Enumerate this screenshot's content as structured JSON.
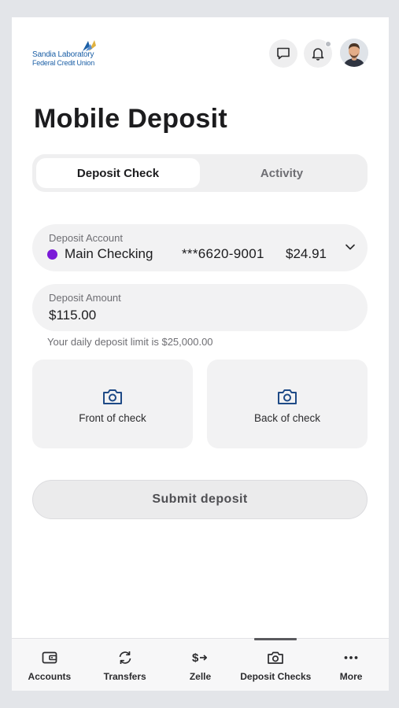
{
  "header": {
    "logo_line1": "Sandia Laboratory",
    "logo_line2": "Federal Credit Union",
    "icons": [
      "chat-icon",
      "bell-icon",
      "avatar"
    ]
  },
  "page": {
    "title": "Mobile Deposit"
  },
  "tabs": [
    {
      "label": "Deposit Check",
      "active": true
    },
    {
      "label": "Activity",
      "active": false
    }
  ],
  "deposit_account": {
    "label": "Deposit Account",
    "name": "Main Checking",
    "number": "***6620-9001",
    "balance": "$24.91",
    "dot_color": "#7a19d8"
  },
  "deposit_amount": {
    "label": "Deposit Amount",
    "value": "$115.00"
  },
  "limit_note": "Your daily deposit limit is $25,000.00",
  "check_tiles": {
    "front_label": "Front of check",
    "back_label": "Back of check"
  },
  "submit_label": "Submit deposit",
  "bottom_nav": [
    {
      "label": "Accounts",
      "icon": "wallet-icon"
    },
    {
      "label": "Transfers",
      "icon": "transfer-arrows-icon"
    },
    {
      "label": "Zelle",
      "icon": "zelle-icon"
    },
    {
      "label": "Deposit Checks",
      "icon": "camera-icon",
      "active": true
    },
    {
      "label": "More",
      "icon": "more-dots-icon"
    }
  ],
  "colors": {
    "brand_blue": "#1b5fa6",
    "icon_blue": "#1e4a86",
    "account_dot": "#7a19d8"
  }
}
